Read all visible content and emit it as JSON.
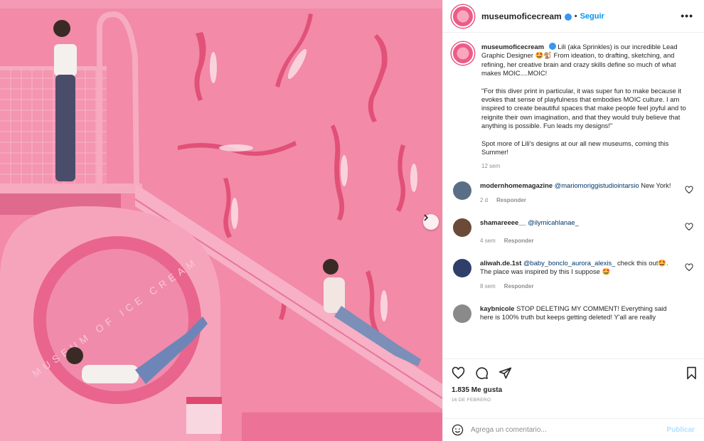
{
  "post": {
    "username": "museumoficecream",
    "follow_label": "Seguir",
    "separator": "•",
    "more_label": "•••"
  },
  "media": {
    "sign_text": "MUSEUM OF ICE CREAM",
    "colors": {
      "wall": "#f18aa8",
      "slide": "#f5a3bd",
      "figure": "#e8456f"
    }
  },
  "caption": {
    "username": "museumoficecream",
    "text_1": "Lili (aka Sprinkles) is our incredible Lead Graphic Designer 🤩🐒 From ideation, to drafting, sketching, and refining, her creative brain and crazy skills define so much of what makes MOIC....MOIC!",
    "text_2": "\"For this diver print in particular, it was super fun to make because it evokes that sense of playfulness that embodies MOIC culture. I am inspired to create beautiful spaces that make people feel joyful and to reignite their own imagination, and that they would truly believe that anything is possible. Fun leads my designs!\"",
    "text_3": "Spot more of Lili's designs at our all new museums, coming this Summer!",
    "time": "12 sem"
  },
  "comments": [
    {
      "username": "modernhomemagazine",
      "mention": "@mariomoriggistudiointarsio",
      "text": " New York!",
      "time": "2 d",
      "reply": "Responder",
      "avatar_color": "#5a6f86"
    },
    {
      "username": "shamareeee__",
      "mention": "@ilymicahlanae_",
      "text": "",
      "time": "4 sem",
      "reply": "Responder",
      "avatar_color": "#6b4a38"
    },
    {
      "username": "aliwah.de.1st",
      "mention": "@baby_bonclo_aurora_alexis_",
      "text": " check this out🤩. The place was inspired by this I suppose 🤩",
      "time": "8 sem",
      "reply": "Responder",
      "avatar_color": "#2f3f6a"
    },
    {
      "username": "kaybnicole",
      "mention": "",
      "text": "STOP DELETING MY COMMENT! Everything said here is 100% truth but keeps getting deleted! Y'all are really",
      "avatar_color": "#8a8a8a"
    }
  ],
  "footer": {
    "likes": "1.835 Me gusta",
    "date": "16 DE FEBRERO",
    "comment_placeholder": "Agrega un comentario...",
    "publish_label": "Publicar"
  }
}
